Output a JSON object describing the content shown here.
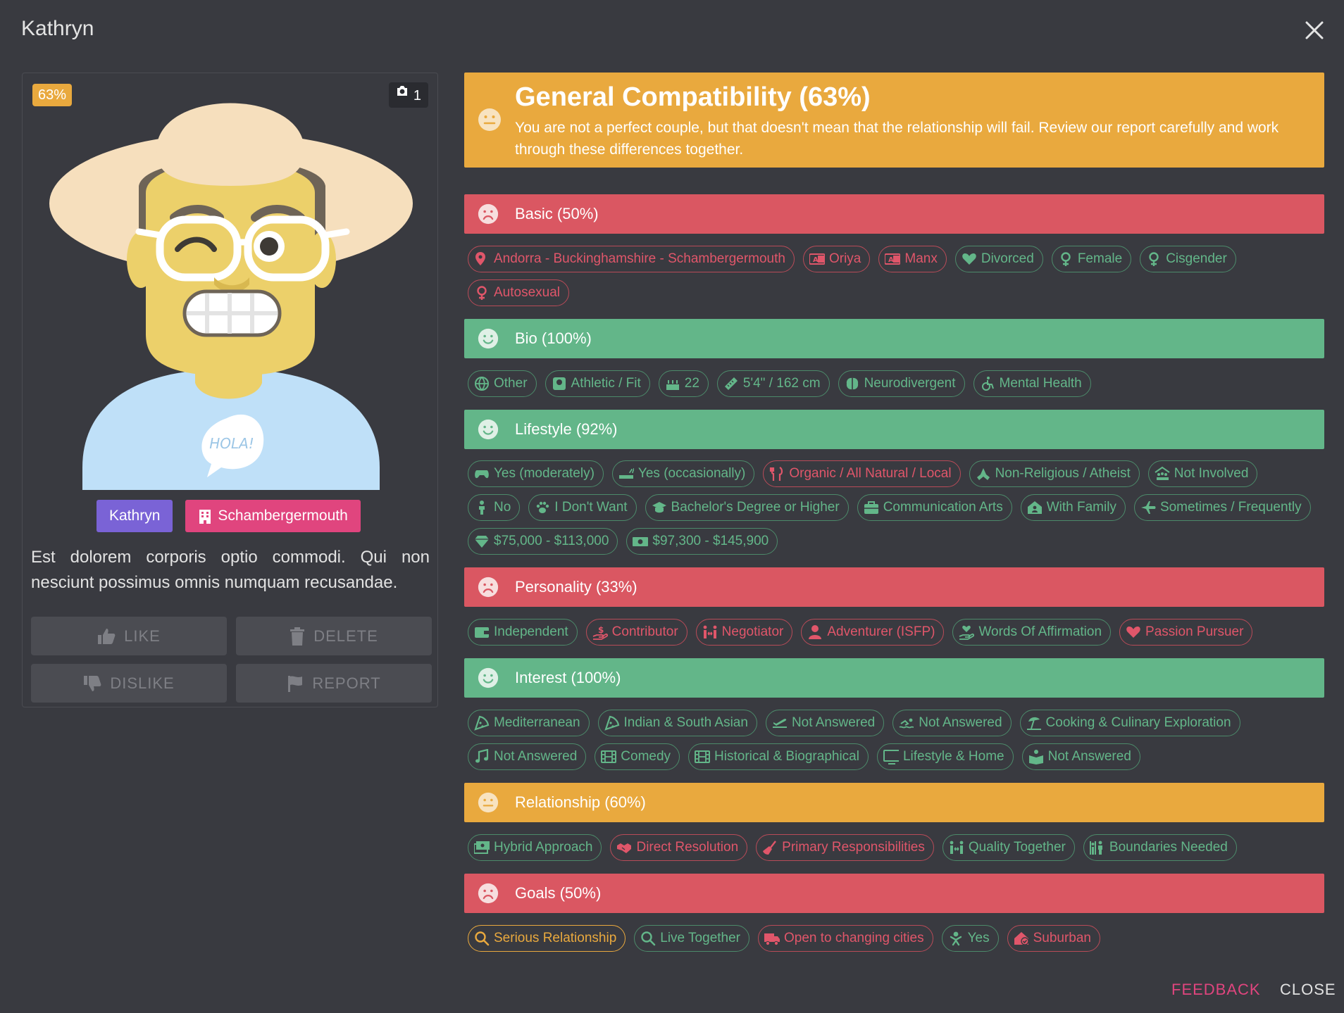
{
  "dialog": {
    "title": "Kathryn",
    "feedback": "FEEDBACK",
    "close": "CLOSE"
  },
  "profile": {
    "match_pct": "63%",
    "photo_count": "1",
    "name": "Kathryn",
    "city": "Schambergermouth",
    "bio": "Est dolorem corporis optio commodi. Qui non nesciunt possimus omnis numquam recusandae.",
    "speech_bubble": "HOLA!",
    "actions": {
      "like": "LIKE",
      "delete": "DELETE",
      "dislike": "DISLIKE",
      "report": "REPORT"
    }
  },
  "general": {
    "title": "General Compatibility (63%)",
    "description": "You are not a perfect couple, but that doesn't mean that the relationship will fail. Review our report carefully and work through these differences together."
  },
  "sections": {
    "basic": {
      "label": "Basic (50%)",
      "tags": [
        {
          "text": "Andorra - Buckinghamshire - Schambergermouth",
          "icon": "map-pin-icon"
        },
        {
          "text": "Oriya",
          "icon": "language-icon"
        },
        {
          "text": "Manx",
          "icon": "language-icon"
        },
        {
          "text": "Divorced",
          "icon": "heart-icon"
        },
        {
          "text": "Female",
          "icon": "gender-icon"
        },
        {
          "text": "Cisgender",
          "icon": "gender-icon"
        },
        {
          "text": "Autosexual",
          "icon": "gender-icon"
        }
      ]
    },
    "bio": {
      "label": "Bio (100%)",
      "tags": [
        {
          "text": "Other",
          "icon": "globe-icon"
        },
        {
          "text": "Athletic / Fit",
          "icon": "scale-icon"
        },
        {
          "text": "22",
          "icon": "cake-icon"
        },
        {
          "text": "5'4\" / 162 cm",
          "icon": "ruler-icon"
        },
        {
          "text": "Neurodivergent",
          "icon": "brain-icon"
        },
        {
          "text": "Mental Health",
          "icon": "wheelchair-icon"
        }
      ]
    },
    "lifestyle": {
      "label": "Lifestyle (92%)",
      "tags": [
        {
          "text": "Yes (moderately)",
          "icon": "gamepad-icon"
        },
        {
          "text": "Yes (occasionally)",
          "icon": "smoking-icon"
        },
        {
          "text": "Organic / All Natural / Local",
          "icon": "utensils-icon"
        },
        {
          "text": "Non-Religious / Atheist",
          "icon": "praying-hands-icon"
        },
        {
          "text": "Not Involved",
          "icon": "people-roof-icon"
        },
        {
          "text": "No",
          "icon": "child-icon"
        },
        {
          "text": "I Don't Want",
          "icon": "paw-icon"
        },
        {
          "text": "Bachelor's Degree or Higher",
          "icon": "graduation-cap-icon"
        },
        {
          "text": "Communication Arts",
          "icon": "briefcase-icon"
        },
        {
          "text": "With Family",
          "icon": "house-user-icon"
        },
        {
          "text": "Sometimes / Frequently",
          "icon": "plane-icon"
        },
        {
          "text": "$75,000 - $113,000",
          "icon": "gem-icon"
        },
        {
          "text": "$97,300 - $145,900",
          "icon": "money-bill-icon"
        }
      ]
    },
    "personality": {
      "label": "Personality (33%)",
      "tags": [
        {
          "text": "Independent",
          "icon": "wallet-icon"
        },
        {
          "text": "Contributor",
          "icon": "hand-holding-dollar-icon"
        },
        {
          "text": "Negotiator",
          "icon": "people-arrows-icon"
        },
        {
          "text": "Adventurer (ISFP)",
          "icon": "user-icon"
        },
        {
          "text": "Words Of Affirmation",
          "icon": "hand-holding-heart-icon"
        },
        {
          "text": "Passion Pursuer",
          "icon": "heart-icon"
        }
      ]
    },
    "interest": {
      "label": "Interest (100%)",
      "tags": [
        {
          "text": "Mediterranean",
          "icon": "pizza-icon"
        },
        {
          "text": "Indian & South Asian",
          "icon": "pizza-icon"
        },
        {
          "text": "Not Answered",
          "icon": "plane-departure-icon"
        },
        {
          "text": "Not Answered",
          "icon": "swimmer-icon"
        },
        {
          "text": "Cooking & Culinary Exploration",
          "icon": "umbrella-beach-icon"
        },
        {
          "text": "Not Answered",
          "icon": "music-icon"
        },
        {
          "text": "Comedy",
          "icon": "film-icon"
        },
        {
          "text": "Historical & Biographical",
          "icon": "film-icon"
        },
        {
          "text": "Lifestyle & Home",
          "icon": "tv-icon"
        },
        {
          "text": "Not Answered",
          "icon": "book-reader-icon"
        }
      ]
    },
    "relationship": {
      "label": "Relationship (60%)",
      "tags": [
        {
          "text": "Hybrid Approach",
          "icon": "money-bills-icon"
        },
        {
          "text": "Direct Resolution",
          "icon": "handshake-icon"
        },
        {
          "text": "Primary Responsibilities",
          "icon": "broom-icon"
        },
        {
          "text": "Quality Together",
          "icon": "people-arrows-icon"
        },
        {
          "text": "Boundaries Needed",
          "icon": "person-booth-icon"
        }
      ]
    },
    "goals": {
      "label": "Goals (50%)",
      "tags": [
        {
          "text": "Serious Relationship",
          "icon": "search-icon"
        },
        {
          "text": "Live Together",
          "icon": "search-icon"
        },
        {
          "text": "Open to changing cities",
          "icon": "truck-icon"
        },
        {
          "text": "Yes",
          "icon": "baby-icon"
        },
        {
          "text": "Suburban",
          "icon": "house-circle-check-icon"
        }
      ]
    }
  },
  "colors": {
    "green": "#63b689",
    "red": "#e0566a",
    "orange": "#e9a93e",
    "background": "#393a40"
  }
}
